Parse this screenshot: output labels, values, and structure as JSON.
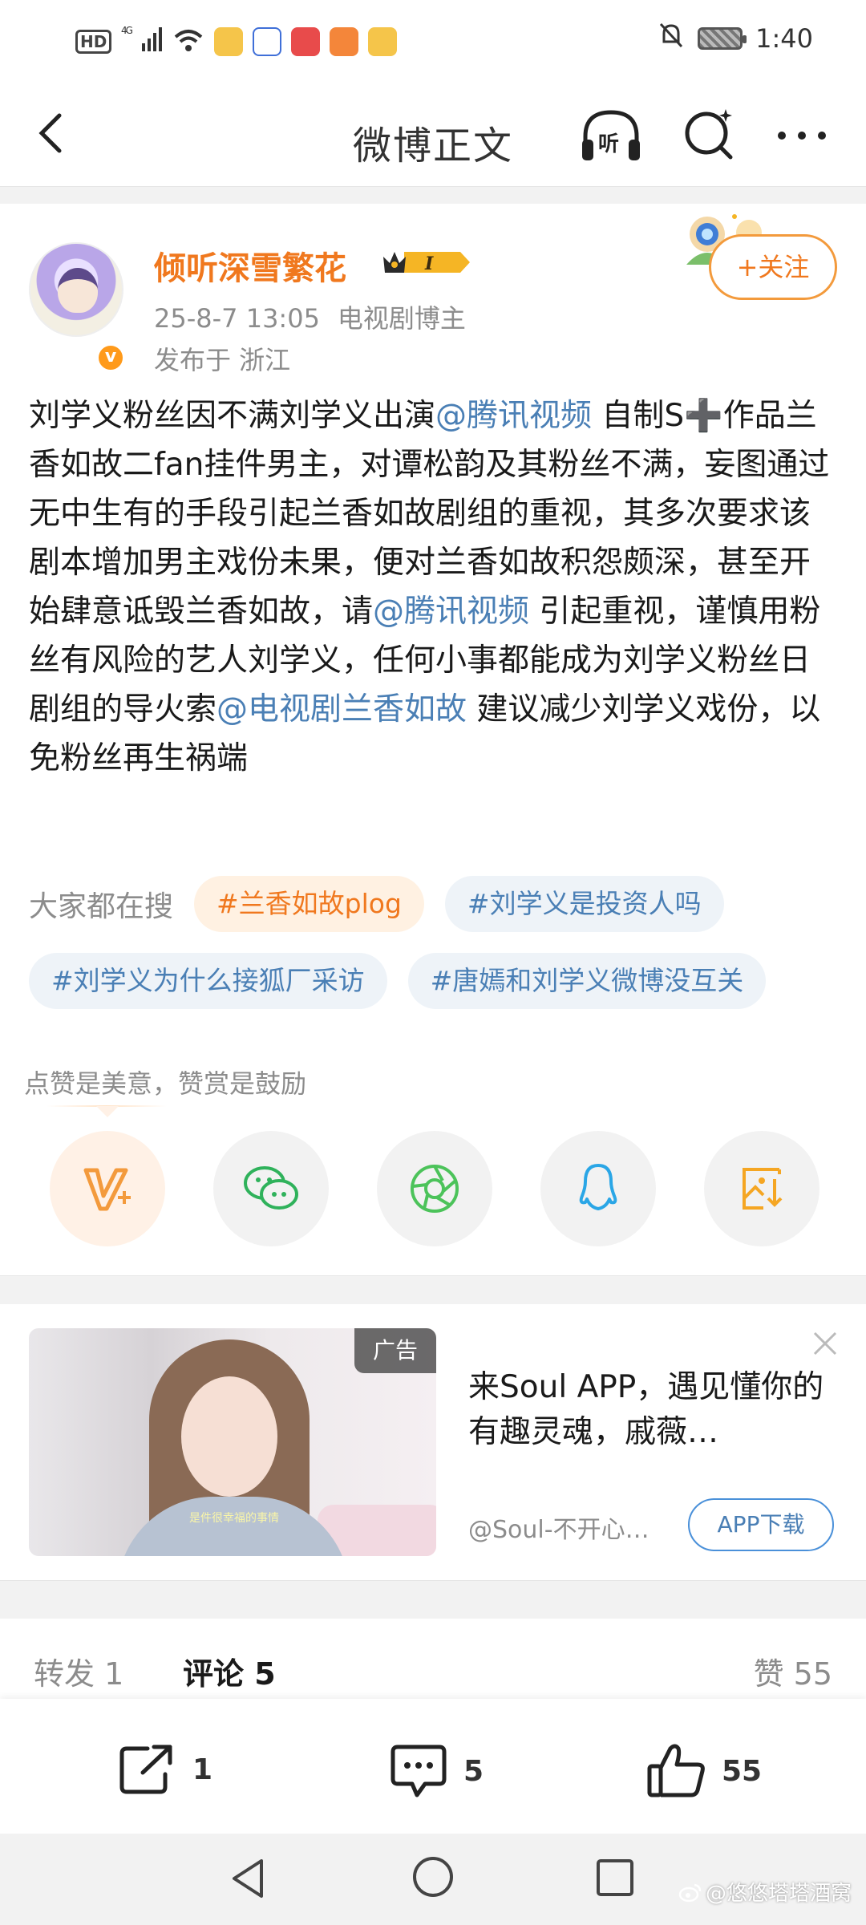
{
  "status_bar": {
    "hd": "HD",
    "network": "4G",
    "time": "1:40"
  },
  "nav": {
    "title": "微博正文"
  },
  "post": {
    "username": "倾听深雪繁花",
    "vip_level": "I",
    "date": "25-8-7 13:05",
    "source": "电视剧博主",
    "location": "发布于 浙江",
    "follow_label": "+关注",
    "content": {
      "t1": "刘学义粉丝因不满刘学义出演",
      "m1": "@腾讯视频",
      "t2": " 自制S➕作品兰香如故二fan挂件男主，对谭松韵及其粉丝不满，妄图通过无中生有的手段引起兰香如故剧组的重视，其多次要求该剧本增加男主戏份未果，便对兰香如故积怨颇深，甚至开始肆意诋毁兰香如故，请",
      "m2": "@腾讯视频",
      "t3": " 引起重视，谨慎用粉丝有风险的艺人刘学义，任何小事都能成为刘学义粉丝日剧组的导火索",
      "m3": "@电视剧兰香如故",
      "t4": " 建议减少刘学义戏份，以免粉丝再生祸端"
    },
    "search_label": "大家都在搜",
    "tags": [
      "#兰香如故plog",
      "#刘学义是投资人吗",
      "#刘学义为什么接狐厂采访",
      "#唐嫣和刘学义微博没互关"
    ],
    "reward_text": "点赞是美意，赞赏是鼓励",
    "share_icons": [
      "reward-v-icon",
      "wechat-icon",
      "moments-icon",
      "qq-icon",
      "save-image-icon"
    ]
  },
  "ad": {
    "badge": "广告",
    "subtitle": "是件很幸福的事情",
    "title": "来Soul APP，遇见懂你的有趣灵魂，戚薇…",
    "source": "@Soul-不开心…",
    "download_label": "APP下载"
  },
  "tabs": {
    "repost": "转发 1",
    "comment": "评论 5",
    "like": "赞 55"
  },
  "actions": {
    "repost_count": "1",
    "comment_count": "5",
    "like_count": "55"
  },
  "watermark": "@悠悠塔塔酒窝",
  "colors": {
    "accent_orange": "#f0781e",
    "link_blue": "#4a7fb5",
    "gray_text": "#8c8c8c",
    "divider": "#f2f2f2"
  }
}
